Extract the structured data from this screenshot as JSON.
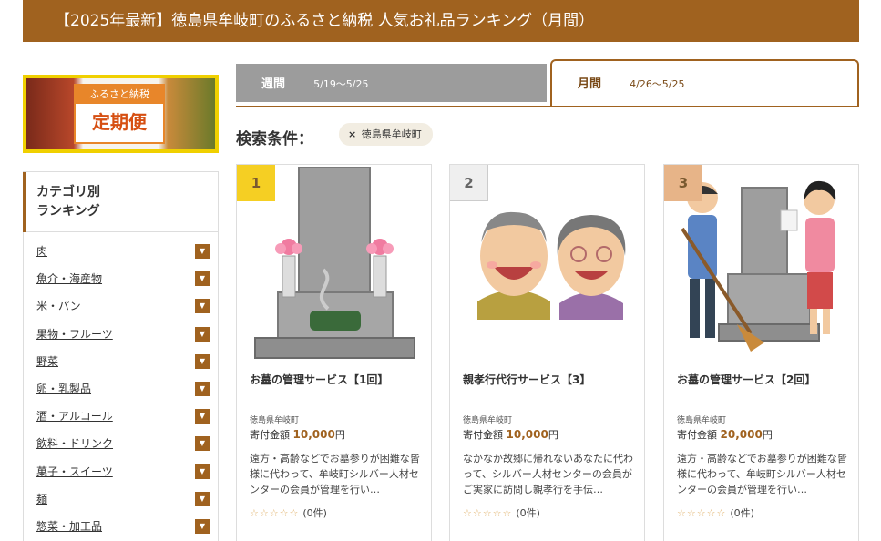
{
  "page": {
    "title": "【2025年最新】徳島県牟岐町のふるさと納税 人気お礼品ランキング（月間）"
  },
  "banner": {
    "line1": "ふるさと納税",
    "line2": "定期便"
  },
  "categories": {
    "heading_line1": "カテゴリ別",
    "heading_line2": "ランキング",
    "items": [
      "肉",
      "魚介・海産物",
      "米・パン",
      "果物・フルーツ",
      "野菜",
      "卵・乳製品",
      "酒・アルコール",
      "飲料・ドリンク",
      "菓子・スイーツ",
      "麺",
      "惣菜・加工品"
    ],
    "arrow_glyph": "▼"
  },
  "tabs": [
    {
      "name": "週間",
      "dates": "5/19〜5/25",
      "active": false
    },
    {
      "name": "月間",
      "dates": "4/26〜5/25",
      "active": true
    }
  ],
  "search": {
    "label": "検索条件：",
    "chip_x": "×",
    "chip_label": "徳島県牟岐町"
  },
  "products": [
    {
      "rank": "1",
      "name": "お墓の管理サービス【1回】",
      "location": "徳島県牟岐町",
      "price_label": "寄付金額",
      "price_amount": "10,000",
      "price_unit": "円",
      "description": "遠方・高齢などでお墓参りが困難な皆様に代わって、牟岐町シルバー人材センターの会員が管理を行い…",
      "stars": "☆☆☆☆☆",
      "reviews": "(0件)"
    },
    {
      "rank": "2",
      "name": "親孝行代行サービス【3】",
      "location": "徳島県牟岐町",
      "price_label": "寄付金額",
      "price_amount": "10,000",
      "price_unit": "円",
      "description": "なかなか故郷に帰れないあなたに代わって、シルバー人材センターの会員がご実家に訪問し親孝行を手伝…",
      "stars": "☆☆☆☆☆",
      "reviews": "(0件)"
    },
    {
      "rank": "3",
      "name": "お墓の管理サービス【2回】",
      "location": "徳島県牟岐町",
      "price_label": "寄付金額",
      "price_amount": "20,000",
      "price_unit": "円",
      "description": "遠方・高齢などでお墓参りが困難な皆様に代わって、牟岐町シルバー人材センターの会員が管理を行い…",
      "stars": "☆☆☆☆☆",
      "reviews": "(0件)"
    }
  ],
  "colors": {
    "brand": "#a0621f",
    "rank_gold": "#f5cf23",
    "rank_silver": "#efefef",
    "rank_bronze": "#e7b488",
    "tab_inactive": "#9c9c9c"
  }
}
